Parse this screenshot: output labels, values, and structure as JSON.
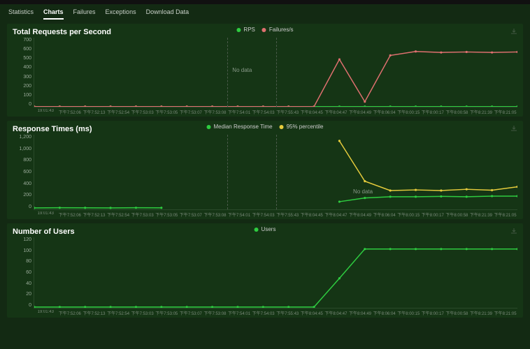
{
  "tabs": {
    "statistics": "Statistics",
    "charts": "Charts",
    "failures": "Failures",
    "exceptions": "Exceptions",
    "download": "Download Data",
    "active": "charts"
  },
  "panels": {
    "rps": {
      "title": "Total Requests per Second",
      "legend": {
        "rps": "RPS",
        "failures": "Failures/s"
      },
      "no_data": "No data",
      "yticks": [
        "0",
        "100",
        "200",
        "300",
        "400",
        "500",
        "600",
        "700"
      ]
    },
    "rt": {
      "title": "Response Times (ms)",
      "legend": {
        "median": "Median Response Time",
        "p95": "95% percentile"
      },
      "no_data": "No data",
      "yticks": [
        "0",
        "200",
        "400",
        "600",
        "800",
        "1,000",
        "1,200"
      ]
    },
    "users": {
      "title": "Number of Users",
      "legend": {
        "users": "Users"
      },
      "yticks": [
        "0",
        "20",
        "40",
        "60",
        "80",
        "100",
        "120"
      ]
    }
  },
  "xticks": [
    "19:01:43",
    "下午7:52:06",
    "下午7:52:13",
    "下午7:52:54",
    "下午7:53:03",
    "下午7:53:05",
    "下午7:53:07",
    "下午7:53:08",
    "下午7:54:01",
    "下午7:54:03",
    "下午7:55:43",
    "下午8:04:45",
    "下午8:04:47",
    "下午8:04:49",
    "下午8:06:04",
    "下午8:00:15",
    "下午8:00:17",
    "下午8:00:58",
    "下午8:21:39",
    "下午8:21:05"
  ],
  "chart_data": [
    {
      "type": "line",
      "title": "Total Requests per Second",
      "xlabel": "",
      "ylabel": "",
      "ylim": [
        0,
        700
      ],
      "x_index": [
        0,
        1,
        2,
        3,
        4,
        5,
        6,
        7,
        8,
        9,
        10,
        11,
        12,
        13,
        14,
        15,
        16,
        17,
        18,
        19
      ],
      "series": [
        {
          "name": "RPS",
          "color": "#2ecc40",
          "values": [
            0,
            0,
            0,
            0,
            0,
            0,
            0,
            0,
            0,
            0,
            0,
            0,
            0,
            0,
            0,
            0,
            0,
            0,
            0,
            0
          ]
        },
        {
          "name": "Failures/s",
          "color": "#e07070",
          "values": [
            0,
            0,
            0,
            0,
            0,
            0,
            0,
            0,
            0,
            0,
            0,
            0,
            480,
            50,
            520,
            560,
            550,
            555,
            550,
            555
          ]
        }
      ],
      "annotations": [
        {
          "text": "No data",
          "x_index": 8
        }
      ],
      "region_breaks": [
        8,
        10
      ]
    },
    {
      "type": "line",
      "title": "Response Times (ms)",
      "xlabel": "",
      "ylabel": "",
      "ylim": [
        0,
        1200
      ],
      "x_index": [
        0,
        1,
        2,
        3,
        4,
        5,
        6,
        7,
        8,
        9,
        10,
        11,
        12,
        13,
        14,
        15,
        16,
        17,
        18,
        19
      ],
      "series": [
        {
          "name": "Median Response Time",
          "color": "#2ecc40",
          "values": [
            20,
            22,
            21,
            20,
            22,
            21,
            null,
            null,
            null,
            null,
            null,
            null,
            120,
            180,
            200,
            200,
            205,
            200,
            210,
            210
          ]
        },
        {
          "name": "95% percentile",
          "color": "#e6cc3c",
          "values": [
            null,
            null,
            null,
            null,
            null,
            null,
            null,
            null,
            null,
            null,
            null,
            null,
            1100,
            450,
            300,
            310,
            300,
            320,
            305,
            360
          ]
        }
      ],
      "annotations": [
        {
          "text": "No data",
          "x_index": 12.5
        }
      ],
      "region_breaks": [
        8,
        10
      ]
    },
    {
      "type": "line",
      "title": "Number of Users",
      "xlabel": "",
      "ylabel": "",
      "ylim": [
        0,
        120
      ],
      "x_index": [
        0,
        1,
        2,
        3,
        4,
        5,
        6,
        7,
        8,
        9,
        10,
        11,
        12,
        13,
        14,
        15,
        16,
        17,
        18,
        19
      ],
      "series": [
        {
          "name": "Users",
          "color": "#2ecc40",
          "values": [
            1,
            1,
            1,
            1,
            1,
            1,
            1,
            1,
            1,
            1,
            1,
            1,
            50,
            100,
            100,
            100,
            100,
            100,
            100,
            100
          ]
        }
      ]
    }
  ]
}
